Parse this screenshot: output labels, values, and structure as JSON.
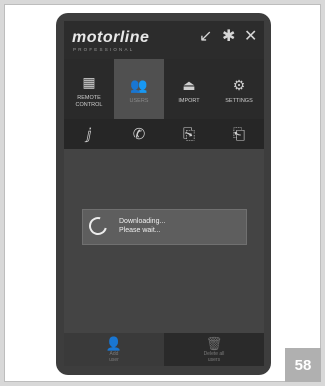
{
  "header": {
    "logo": "motorline",
    "logo_sub": "PROFESSIONAL",
    "icons": [
      "minimize-arrow-icon",
      "bluetooth-icon",
      "close-icon"
    ]
  },
  "tabs": [
    {
      "label": "REMOTE\nCONTROL",
      "icon": "grid-icon",
      "active": false
    },
    {
      "label": "USERS",
      "icon": "users-icon",
      "active": true
    },
    {
      "label": "IMPORT",
      "icon": "import-icon",
      "active": false
    },
    {
      "label": "SETTINGS",
      "icon": "settings-icon",
      "active": false
    }
  ],
  "toolbar": [
    "id-icon",
    "phone-icon",
    "card-in-icon",
    "card-out-icon"
  ],
  "dialog": {
    "line1": "Downloading...",
    "line2": "Please wait..."
  },
  "bottom": {
    "add_label": "Add\nuser",
    "delete_label": "Delete all\nusers"
  },
  "page_number": "58"
}
